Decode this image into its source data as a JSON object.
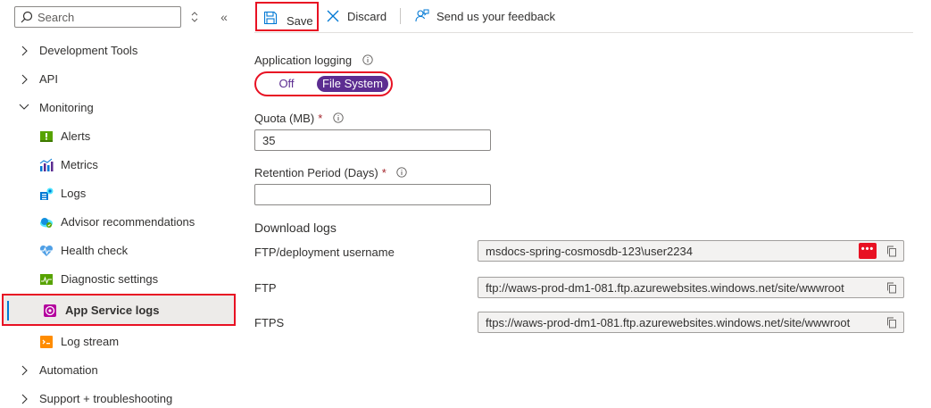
{
  "sidebar": {
    "search_placeholder": "Search",
    "collapse_glyph": "«",
    "items": [
      {
        "label": "Development Tools",
        "icon": "chevron-right-icon"
      },
      {
        "label": "API",
        "icon": "chevron-right-icon"
      },
      {
        "label": "Monitoring",
        "icon": "chevron-down-icon"
      }
    ],
    "monitoring_children": [
      {
        "label": "Alerts",
        "icon": "alerts-icon"
      },
      {
        "label": "Metrics",
        "icon": "metrics-icon"
      },
      {
        "label": "Logs",
        "icon": "logs-icon"
      },
      {
        "label": "Advisor recommendations",
        "icon": "advisor-icon"
      },
      {
        "label": "Health check",
        "icon": "health-check-icon"
      },
      {
        "label": "Diagnostic settings",
        "icon": "diagnostic-settings-icon"
      },
      {
        "label": "App Service logs",
        "icon": "app-service-logs-icon",
        "selected": true
      },
      {
        "label": "Log stream",
        "icon": "log-stream-icon"
      }
    ],
    "bottom_items": [
      {
        "label": "Automation",
        "icon": "chevron-right-icon"
      },
      {
        "label": "Support + troubleshooting",
        "icon": "chevron-right-icon"
      }
    ]
  },
  "toolbar": {
    "save_label": "Save",
    "discard_label": "Discard",
    "feedback_label": "Send us your feedback"
  },
  "form": {
    "app_logging_label": "Application logging",
    "toggle_off_label": "Off",
    "toggle_on_label": "File System",
    "toggle_selected": "File System",
    "quota_label": "Quota (MB)",
    "quota_value": "35",
    "retention_label": "Retention Period (Days)",
    "retention_value": "",
    "required_marker": "*",
    "download_title": "Download logs",
    "ftp_user_label": "FTP/deployment username",
    "ftp_user_value": "msdocs-spring-cosmosdb-123\\user2234",
    "ftp_label": "FTP",
    "ftp_value": "ftp://waws-prod-dm1-081.ftp.azurewebsites.windows.net/site/wwwroot",
    "ftps_label": "FTPS",
    "ftps_value": "ftps://waws-prod-dm1-081.ftp.azurewebsites.windows.net/site/wwwroot",
    "more_glyph": "•••"
  },
  "colors": {
    "accent_purple": "#5c2d91",
    "highlight_red": "#e81123",
    "selection_bar": "#0078d4"
  }
}
